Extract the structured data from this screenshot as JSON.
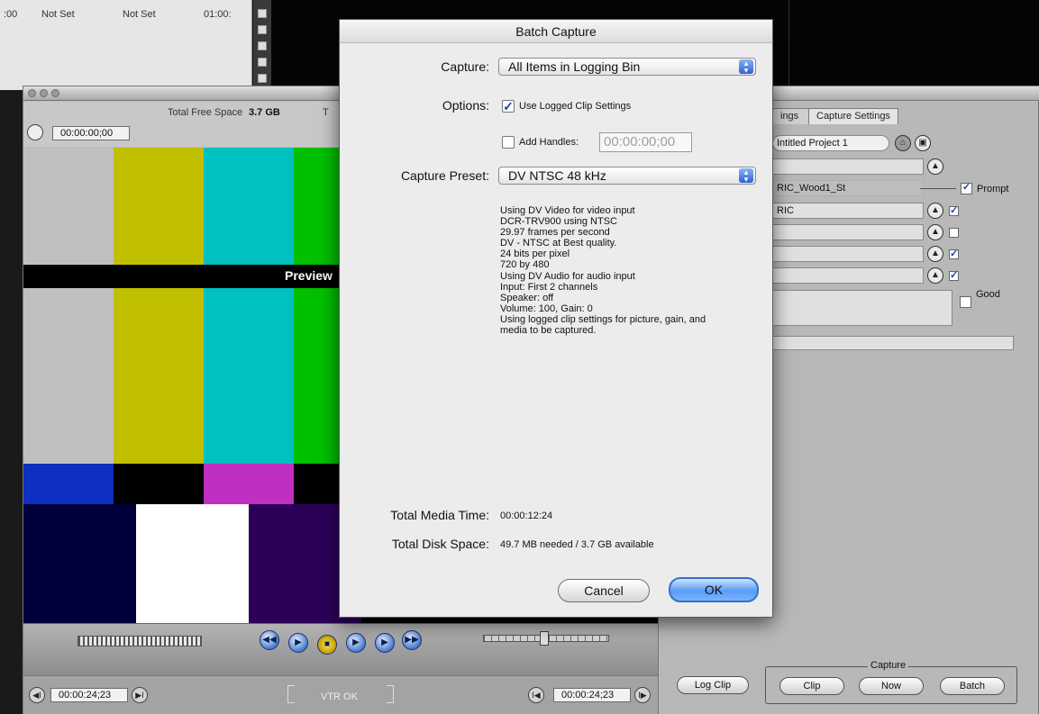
{
  "browser": {
    "cells": [
      ":00",
      "Not Set",
      "Not Set",
      "01:00:"
    ]
  },
  "viewer": {
    "free_space_label": "Total Free Space",
    "free_space_value": "3.7 GB",
    "free_space_label_trunc": "T",
    "timecode_top": "00:00:00;00",
    "preview_label": "Preview",
    "timecode_in": "00:00:24;23",
    "timecode_out": "00:00:24;23",
    "vtr_status": "VTR OK"
  },
  "capture_panel": {
    "tabs": [
      "ings",
      "Capture Settings"
    ],
    "project": "Intitled Project 1",
    "description": "RIC_Wood1_St",
    "scene": "RIC",
    "prompt_label": "Prompt",
    "good_label": "Good",
    "log_clip_label": "Log Clip",
    "capture_group_label": "Capture",
    "clip_label": "Clip",
    "now_label": "Now",
    "batch_label": "Batch"
  },
  "dialog": {
    "title": "Batch Capture",
    "capture_label": "Capture:",
    "capture_value": "All Items in Logging Bin",
    "options_label": "Options:",
    "use_logged_label": "Use Logged Clip Settings",
    "use_logged_checked": true,
    "add_handles_label": "Add Handles:",
    "add_handles_checked": false,
    "handles_value": "00:00:00;00",
    "preset_label": "Capture Preset:",
    "preset_value": "DV NTSC 48 kHz",
    "preset_info": [
      "Using DV Video for video input",
      "DCR-TRV900 using NTSC",
      "29.97 frames per second",
      "DV - NTSC at Best quality.",
      "24 bits per pixel",
      "720 by 480",
      "Using DV Audio for audio input",
      "Input: First 2 channels",
      "Speaker: off",
      "Volume: 100, Gain: 0",
      "Using logged clip settings for picture, gain, and",
      "media to be captured."
    ],
    "media_time_label": "Total Media Time:",
    "media_time_value": "00:00:12:24",
    "disk_space_label": "Total Disk Space:",
    "disk_space_value": "49.7 MB needed / 3.7 GB available",
    "cancel_label": "Cancel",
    "ok_label": "OK"
  },
  "colors": {
    "accent": "#3470c8",
    "bar_gray": "#c0c0c0",
    "bar_yellow": "#c0c000",
    "bar_cyan": "#00c0c0",
    "bar_green": "#00c000",
    "bar_blue": "#0000c0",
    "bar_magenta": "#c000c0",
    "bar_navy": "#00003a",
    "bar_white": "#ffffff",
    "bar_purple": "#2c0058"
  }
}
